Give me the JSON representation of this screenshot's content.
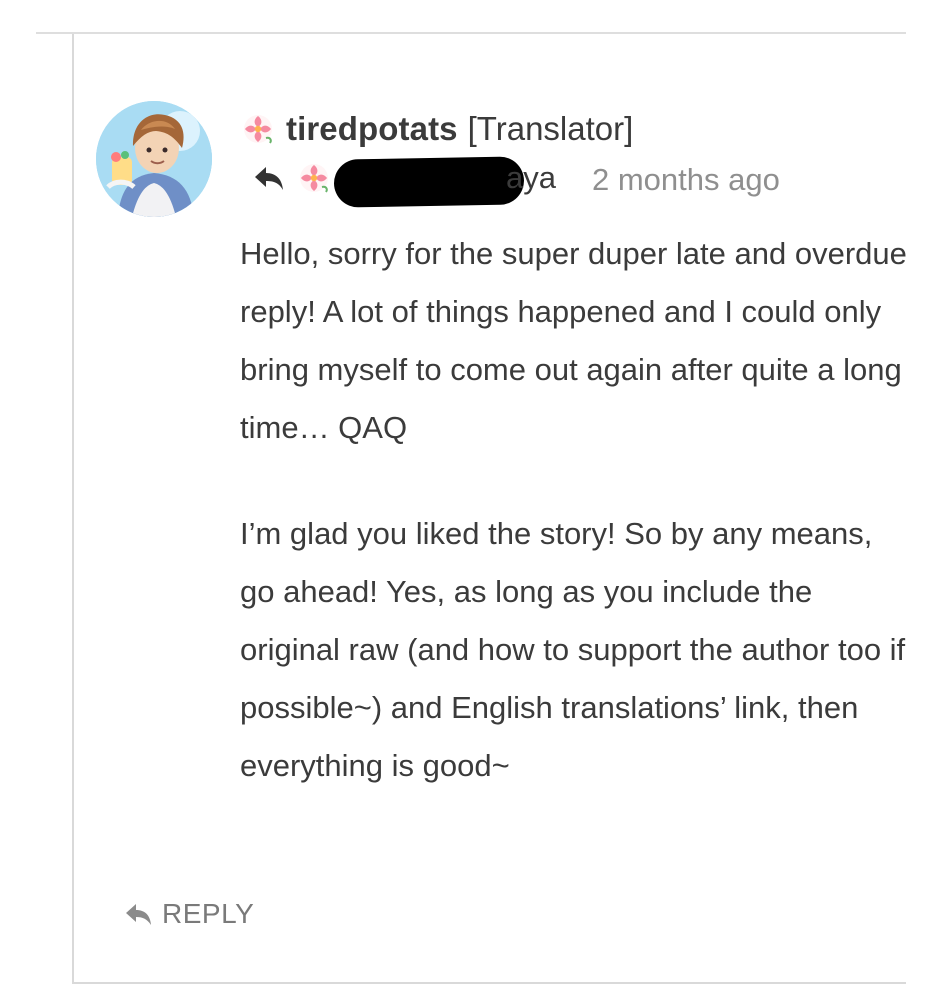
{
  "comment": {
    "author": {
      "name": "tiredpotats",
      "role": "[Translator]",
      "avatar_icon": "avatar-anime-boy",
      "flair_icon": "hibiscus-flower-icon"
    },
    "reply_to": {
      "icon": "reply-arrow-icon",
      "flair_icon": "hibiscus-flower-icon",
      "visible_name_suffix": "aya"
    },
    "timestamp": "2 months ago",
    "body": {
      "paragraph_1": "Hello, sorry for the super duper late and overdue reply! A lot of things happened and I could only bring myself to come out again after quite a long time… QAQ",
      "paragraph_2": "I’m glad you liked the story! So by any means, go ahead! Yes, as long as you include the original raw (and how to support the author too if possible~) and English translations’ link, then everything is good~"
    },
    "actions": {
      "reply_label": "REPLY",
      "reply_icon": "reply-arrow-icon"
    },
    "colors": {
      "text": "#3b3b3b",
      "muted": "#8f8f8f",
      "border": "#d9d9d9",
      "flower": "#f58aa0"
    }
  }
}
